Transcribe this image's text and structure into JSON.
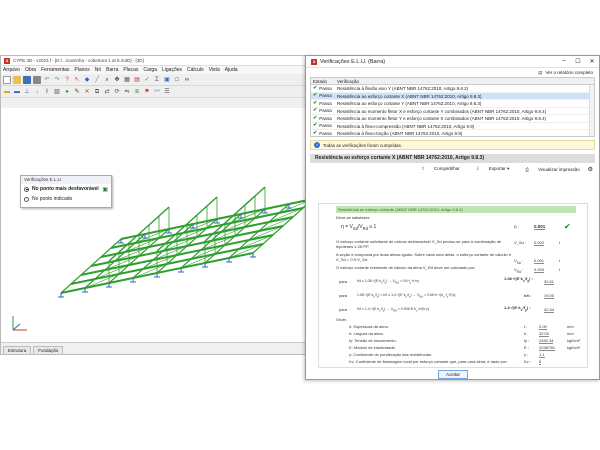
{
  "main_window": {
    "title": "CYPE 3D - v2023.f - [D:\\...\\cazenha - cobertura 1 at 6.m3D] - [3D]",
    "menu": [
      "Arquivo",
      "Obra",
      "Ferramentas",
      "Planos",
      "Nó",
      "Barra",
      "Placas",
      "Carga",
      "Ligações",
      "Cálculo",
      "Vista",
      "Ajuda"
    ],
    "float_panel": {
      "title": "Verificações E.L.U.",
      "options": [
        "No ponto mais desfavorável",
        "No ponto indicado"
      ]
    },
    "tabs": [
      "Estrutura",
      "Fundação"
    ]
  },
  "dialog": {
    "title": "Verificações E.L.U. (Barra)",
    "report_link": "Ver o relatório completo",
    "table_headers": [
      "Estado",
      "Verificação"
    ],
    "rows": [
      {
        "estado": "Passa",
        "verificacao": "Resistência à flexão eixo Y (ABNT NBR 14762:2010, Artigo 9.8.2)"
      },
      {
        "estado": "Passa",
        "verificacao": "Resistência ao esforço cortante X (ABNT NBR 14762:2010, Artigo 9.8.3)"
      },
      {
        "estado": "Passa",
        "verificacao": "Resistência ao esforço cortante Y (ABNT NBR 14762:2010, Artigo 9.8.3)"
      },
      {
        "estado": "Passa",
        "verificacao": "Resistência ao momento fletor X e esforço cortante Y combinados (ABNT NBR 14762:2010, Artigo 9.8.4)"
      },
      {
        "estado": "Passa",
        "verificacao": "Resistência ao momento fletor Y e esforço cortante X combinados (ABNT NBR 14762:2010, Artigo 9.8.4)"
      },
      {
        "estado": "Passa",
        "verificacao": "Resistência à flexo-compressão (ABNT NBR 14762:2010, Artigo 9.9)"
      },
      {
        "estado": "Passa",
        "verificacao": "Resistência à flexo-tração (ABNT NBR 14762:2010, Artigo 9.9)"
      }
    ],
    "selected_row": 1,
    "info_text": "Todas as verificações foram cumpridas.",
    "section_title": "Resistência ao esforço cortante X (ABNT NBR 14762:2010, Artigo 9.8.3)",
    "actions": [
      "Compartilhar",
      "Exportar",
      "Visualizar impressão"
    ],
    "report": {
      "heading": "Resistência ao esforço cortante (ABNT NBR 14762:2010, Artigo 9.8.3)",
      "intro": "Deve-se satisfazer:",
      "eta_value": "0.001",
      "line1": "O esforço cortante solicitante de cálculo desfavorável V_Sd produz-se para a combinação de hipóteses 1.25·PP.",
      "vsd_label": "V_Sd :",
      "vsd_value": "0.002",
      "vsd_unit": "t",
      "line2": "A seção é composta por duas almas iguais. Sobre cada uma delas, o esforço cortante de cálculo é V_Sd = 0.5·V_Sd.",
      "vsd2_value": "0.001",
      "line3": "O esforço cortante resistente de cálculo da alma V_Rd deve ser calculado por:",
      "vrd_value": "0.925",
      "ratio_a": "32.61",
      "ratio_b": "19.00",
      "ratio_c": "42.54",
      "onde": "Onde:",
      "params": [
        {
          "desc": "h: Espessura da alma.",
          "sym": "t :",
          "val": "2.00",
          "unit": "mm"
        },
        {
          "desc": "h: Largura da alma.",
          "sym": "h :",
          "val": "32.00",
          "unit": "mm"
        },
        {
          "desc": "fy: Tensão de escoamento.",
          "sym": "fy :",
          "val": "2450.34",
          "unit": "kgf/cm²"
        },
        {
          "desc": "E: Módulo de elasticidade.",
          "sym": "E :",
          "val": "2038736",
          "unit": "kgf/cm²"
        },
        {
          "desc": "γ: Coeficiente de ponderação das resistências.",
          "sym": "γ :",
          "val": "1.1",
          "unit": ""
        },
        {
          "desc": "Kv: Coeficiente de flambagem local por esforço cortante que, para uma alma, é dado por:",
          "sym": "Kv :",
          "val": "5",
          "unit": ""
        }
      ]
    },
    "accept_label": "Aceitar"
  },
  "colors": {
    "beam": "#2e9e2e",
    "support": "#2d66c9",
    "selected_row": "#cfe2f7",
    "info_bg": "#fff7dd"
  }
}
